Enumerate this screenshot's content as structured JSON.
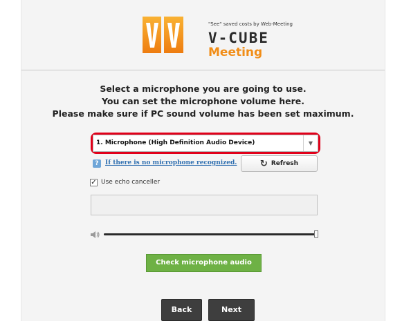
{
  "header": {
    "tagline": "\"See\" saved costs by Web-Meeting",
    "brand_line1": "V-CUBE",
    "brand_line2": "Meeting",
    "logo_icon": "vv-logo-icon",
    "accent_color": "#f18d17"
  },
  "instructions": {
    "line1": "Select a microphone you are going to use.",
    "line2": "You can set the microphone volume here.",
    "line3": "Please make sure if PC sound volume has been set maximum."
  },
  "mic_select": {
    "selected": "1. Microphone (High Definition Audio Device)",
    "highlight_color": "#e1001a"
  },
  "help": {
    "icon_text": "?",
    "link_text": "If there is no microphone recognized."
  },
  "refresh": {
    "label": "Refresh",
    "icon": "refresh-icon"
  },
  "echo": {
    "label": "Use echo canceller",
    "checked": true,
    "check_glyph": "✓"
  },
  "volume": {
    "icon": "speaker-icon",
    "level_percent": 100
  },
  "check_button": {
    "label": "Check microphone audio",
    "color": "#6eb145"
  },
  "nav": {
    "back_label": "Back",
    "next_label": "Next"
  }
}
